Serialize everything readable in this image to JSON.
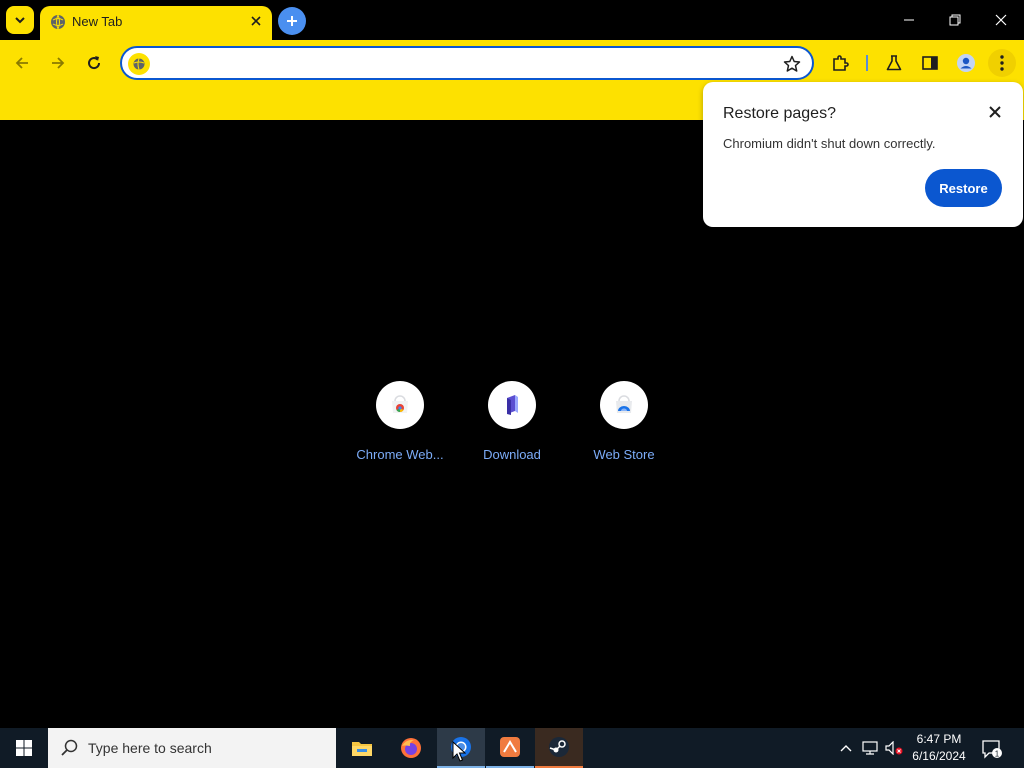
{
  "browser": {
    "tab": {
      "title": "New Tab"
    },
    "omnibox": {
      "value": "",
      "placeholder": ""
    }
  },
  "restore_bubble": {
    "title": "Restore pages?",
    "message": "Chromium didn't shut down correctly.",
    "restore_label": "Restore"
  },
  "shortcuts": [
    {
      "label": "Chrome Web...",
      "icon": "chrome-web-store-icon"
    },
    {
      "label": "Download",
      "icon": "download-icon"
    },
    {
      "label": "Web Store",
      "icon": "web-store-icon"
    }
  ],
  "taskbar": {
    "search_placeholder": "Type here to search",
    "apps": [
      "file-explorer-icon",
      "firefox-icon",
      "chromium-icon",
      "app-orange-icon",
      "steam-icon"
    ],
    "time": "6:47 PM",
    "date": "6/16/2024",
    "notifications_count": "1"
  },
  "colors": {
    "theme_yellow": "#fde100",
    "accent_blue": "#0b57d0",
    "link_blue": "#7cacf8",
    "taskbar": "#101b26"
  }
}
